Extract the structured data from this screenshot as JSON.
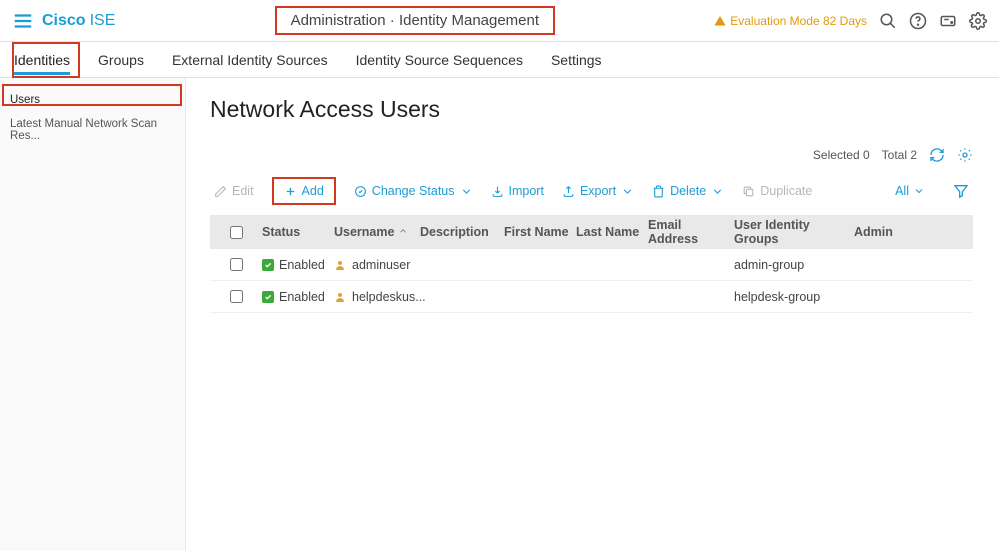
{
  "header": {
    "brand": "Cisco",
    "brand_sub": "ISE",
    "breadcrumb": "Administration · Identity Management",
    "eval_label": "Evaluation Mode 82 Days"
  },
  "topnav": {
    "items": [
      "Identities",
      "Groups",
      "External Identity Sources",
      "Identity Source Sequences",
      "Settings"
    ],
    "active_index": 0
  },
  "sidebar": {
    "items": [
      "Users",
      "Latest Manual Network Scan Res..."
    ],
    "active_index": 0
  },
  "main": {
    "title": "Network Access Users",
    "selected_label": "Selected 0",
    "total_label": "Total 2",
    "toolbar": {
      "edit": "Edit",
      "add": "Add",
      "change_status": "Change Status",
      "import": "Import",
      "export": "Export",
      "delete": "Delete",
      "duplicate": "Duplicate",
      "filter_all": "All"
    },
    "columns": [
      "Status",
      "Username",
      "Description",
      "First Name",
      "Last Name",
      "Email Address",
      "User Identity Groups",
      "Admin"
    ],
    "rows": [
      {
        "status": "Enabled",
        "username": "adminuser",
        "description": "",
        "first_name": "",
        "last_name": "",
        "email": "",
        "group": "admin-group",
        "admin": ""
      },
      {
        "status": "Enabled",
        "username": "helpdeskus...",
        "description": "",
        "first_name": "",
        "last_name": "",
        "email": "",
        "group": "helpdesk-group",
        "admin": ""
      }
    ]
  }
}
